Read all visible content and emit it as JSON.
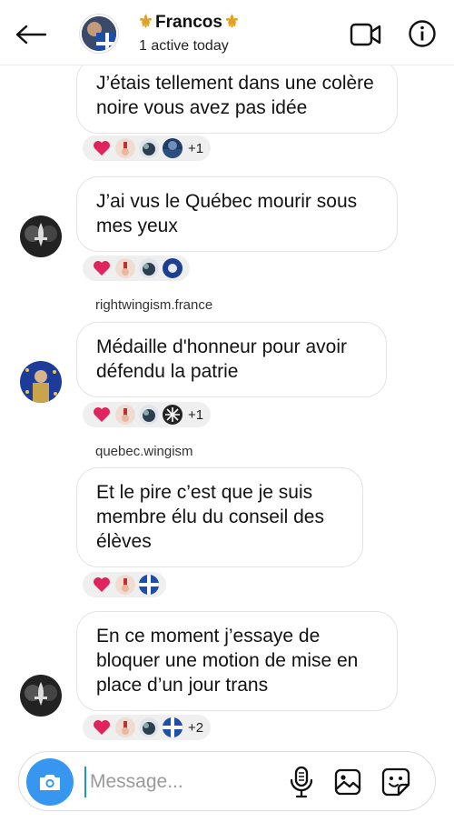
{
  "header": {
    "title": "Francos",
    "title_emoji_left": "⚜",
    "title_emoji_right": "⚜",
    "status": "1 active today",
    "icons": [
      "back-arrow-icon",
      "video-call-icon",
      "info-icon"
    ]
  },
  "messages": [
    {
      "text": "J’étais tellement dans une colère noire vous avez pas idée",
      "reactions": [
        "❤️",
        "✌",
        "🦅",
        "🌎"
      ],
      "count": "+1"
    },
    {
      "text": "J’ai vus le Québec mourir sous mes yeux",
      "reactions": [
        "❤️",
        "✌",
        "🦅",
        "⚜"
      ],
      "count": ""
    },
    {
      "sender": "rightwingism.france",
      "text": "Médaille d'honneur pour avoir défendu la patrie",
      "reactions": [
        "❤️",
        "✌",
        "🦅",
        "✳"
      ],
      "count": "+1"
    },
    {
      "sender": "quebec.wingism",
      "text": "Et le pire c’est que je suis membre élu du conseil des élèves",
      "reactions": [
        "❤️",
        "✌",
        "⚜"
      ],
      "count": ""
    },
    {
      "text": "En ce moment j’essaye de bloquer une motion de mise en place d’un jour trans",
      "reactions": [
        "❤️",
        "✌",
        "🦅",
        "⚜"
      ],
      "count": "+2"
    }
  ],
  "composer": {
    "placeholder": "Message...",
    "value": ""
  },
  "colors": {
    "accent": "#3797f0",
    "bubble_border": "#e3e3e3",
    "reaction_bg": "#efefef",
    "heart": "#e0245e"
  }
}
